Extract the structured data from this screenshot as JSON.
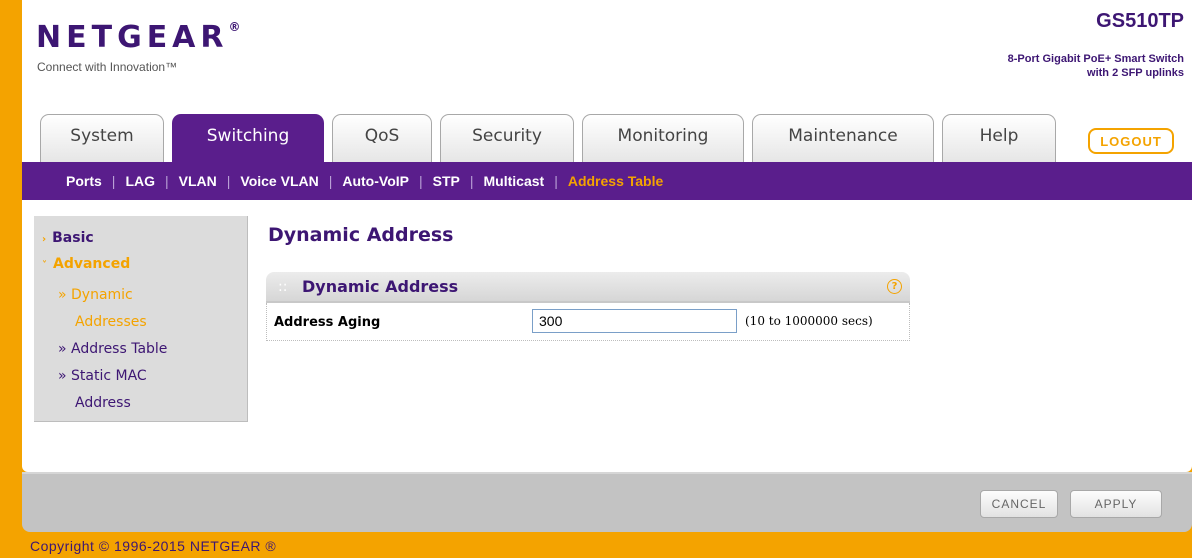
{
  "header": {
    "logo_text": "NETGEAR",
    "logo_mark": "®",
    "tagline": "Connect with Innovation™",
    "model": "GS510TP",
    "model_desc_1": "8-Port Gigabit PoE+ Smart Switch",
    "model_desc_2": "with 2 SFP uplinks"
  },
  "tabs": [
    {
      "label": "System",
      "active": false
    },
    {
      "label": "Switching",
      "active": true
    },
    {
      "label": "QoS",
      "active": false
    },
    {
      "label": "Security",
      "active": false
    },
    {
      "label": "Monitoring",
      "active": false
    },
    {
      "label": "Maintenance",
      "active": false
    },
    {
      "label": "Help",
      "active": false
    }
  ],
  "logout_label": "LOGOUT",
  "subnav": [
    {
      "label": "Ports",
      "active": false
    },
    {
      "label": "LAG",
      "active": false
    },
    {
      "label": "VLAN",
      "active": false
    },
    {
      "label": "Voice VLAN",
      "active": false
    },
    {
      "label": "Auto-VoIP",
      "active": false
    },
    {
      "label": "STP",
      "active": false
    },
    {
      "label": "Multicast",
      "active": false
    },
    {
      "label": "Address Table",
      "active": true
    }
  ],
  "sidebar": {
    "basic": "Basic",
    "advanced": "Advanced",
    "sub_items": [
      {
        "line1": "» Dynamic",
        "line2": "Addresses",
        "active": true
      },
      {
        "line1": "» Address Table",
        "line2": "",
        "active": false
      },
      {
        "line1": "» Static MAC",
        "line2": "Address",
        "active": false
      }
    ]
  },
  "main": {
    "page_title": "Dynamic Address",
    "panel_title": "Dynamic Address",
    "help_glyph": "?",
    "row_label": "Address Aging",
    "row_value": "300",
    "row_hint": "(10 to 1000000 secs)"
  },
  "buttons": {
    "cancel": "CANCEL",
    "apply": "APPLY"
  },
  "copyright": "Copyright © 1996-2015 NETGEAR ®",
  "colors": {
    "brand_purple": "#5a1e8c",
    "accent_orange": "#f4a300"
  }
}
